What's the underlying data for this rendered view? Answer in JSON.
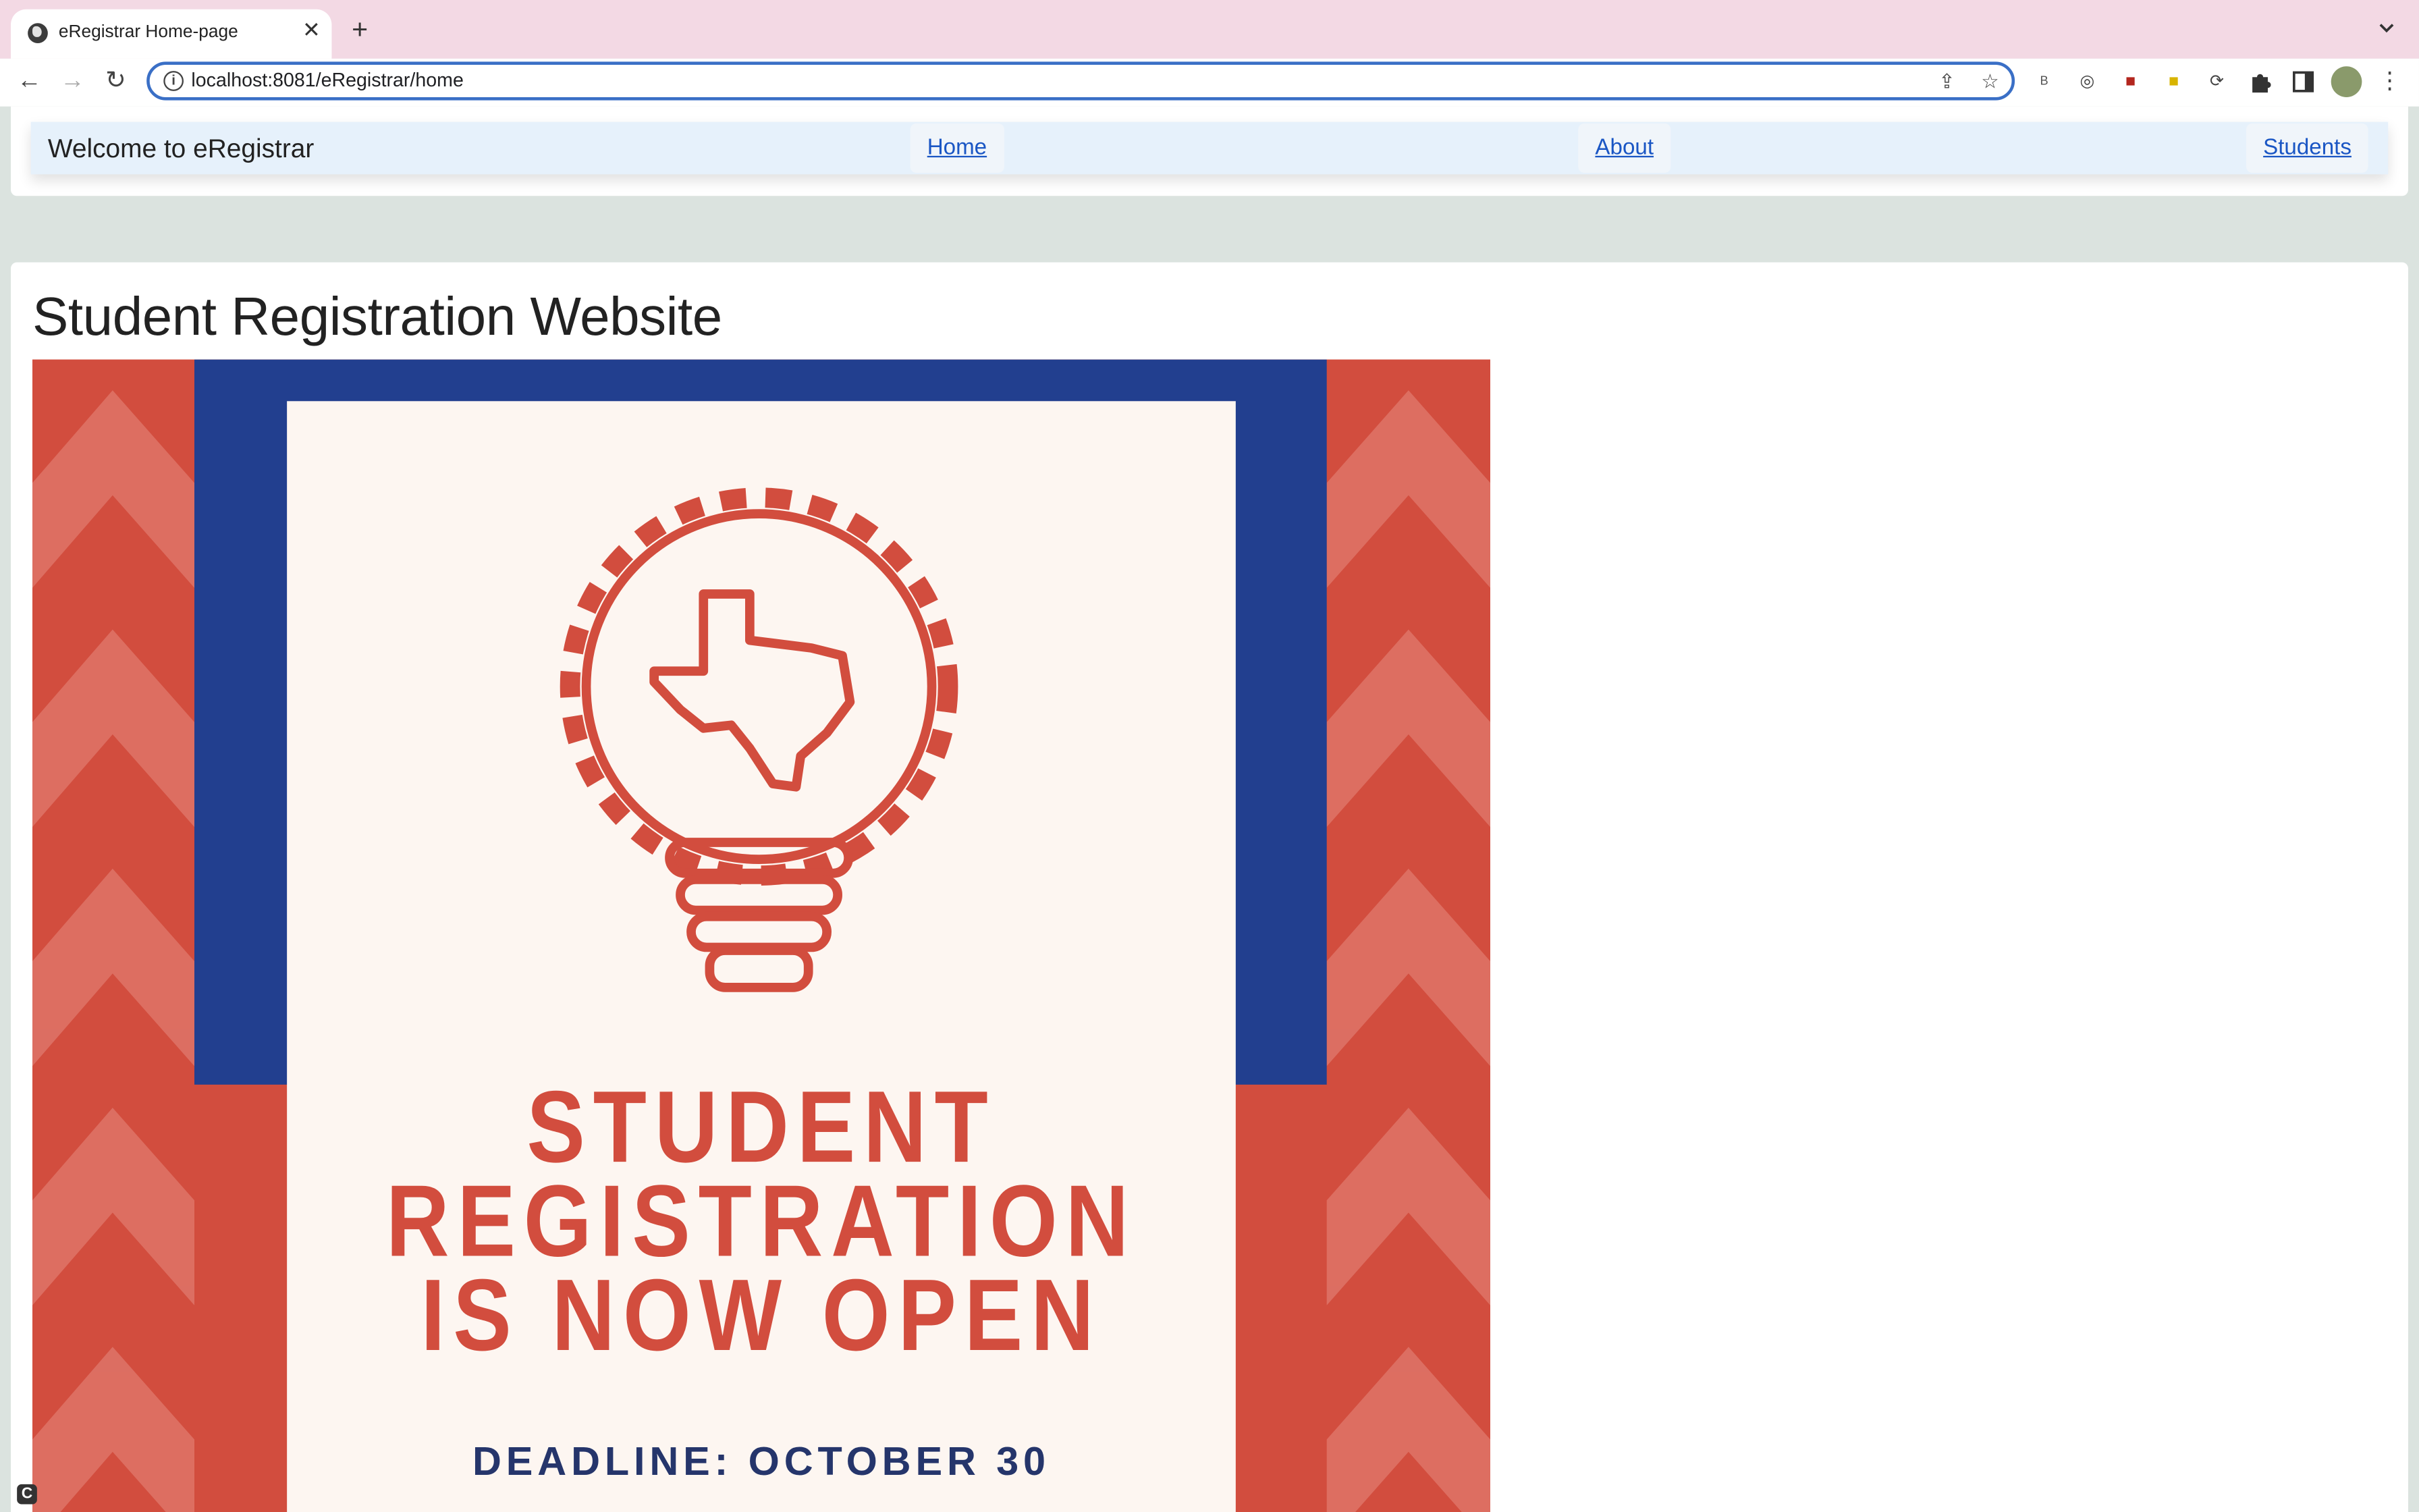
{
  "browser": {
    "tab_title": "eRegistrar Home-page",
    "url": "localhost:8081/eRegistrar/home",
    "icons": [
      "globe-icon",
      "close-icon",
      "plus-icon",
      "chevron-down-icon",
      "back-icon",
      "forward-icon",
      "reload-icon",
      "info-icon",
      "share-icon",
      "star-icon",
      "extensions-icon",
      "sidepanel-icon",
      "avatar",
      "menu-icon"
    ]
  },
  "navbar": {
    "brand": "Welcome to eRegistrar",
    "links": [
      "Home",
      "About",
      "Students"
    ]
  },
  "main": {
    "title": "Student Registration Website",
    "poster": {
      "headline": [
        "STUDENT",
        "REGISTRATION",
        "IS NOW OPEN"
      ],
      "deadline": "DEADLINE: OCTOBER 30",
      "colors": {
        "red": "#d24d3e",
        "blue": "#223f8f",
        "cream": "#fdf6f1",
        "navy": "#25356b"
      }
    }
  },
  "colors": {
    "tabbar": "#f3d9e4",
    "link": "#1a56c4",
    "navbar": "#e6f1fb",
    "page_bg": "#dbe3df"
  }
}
